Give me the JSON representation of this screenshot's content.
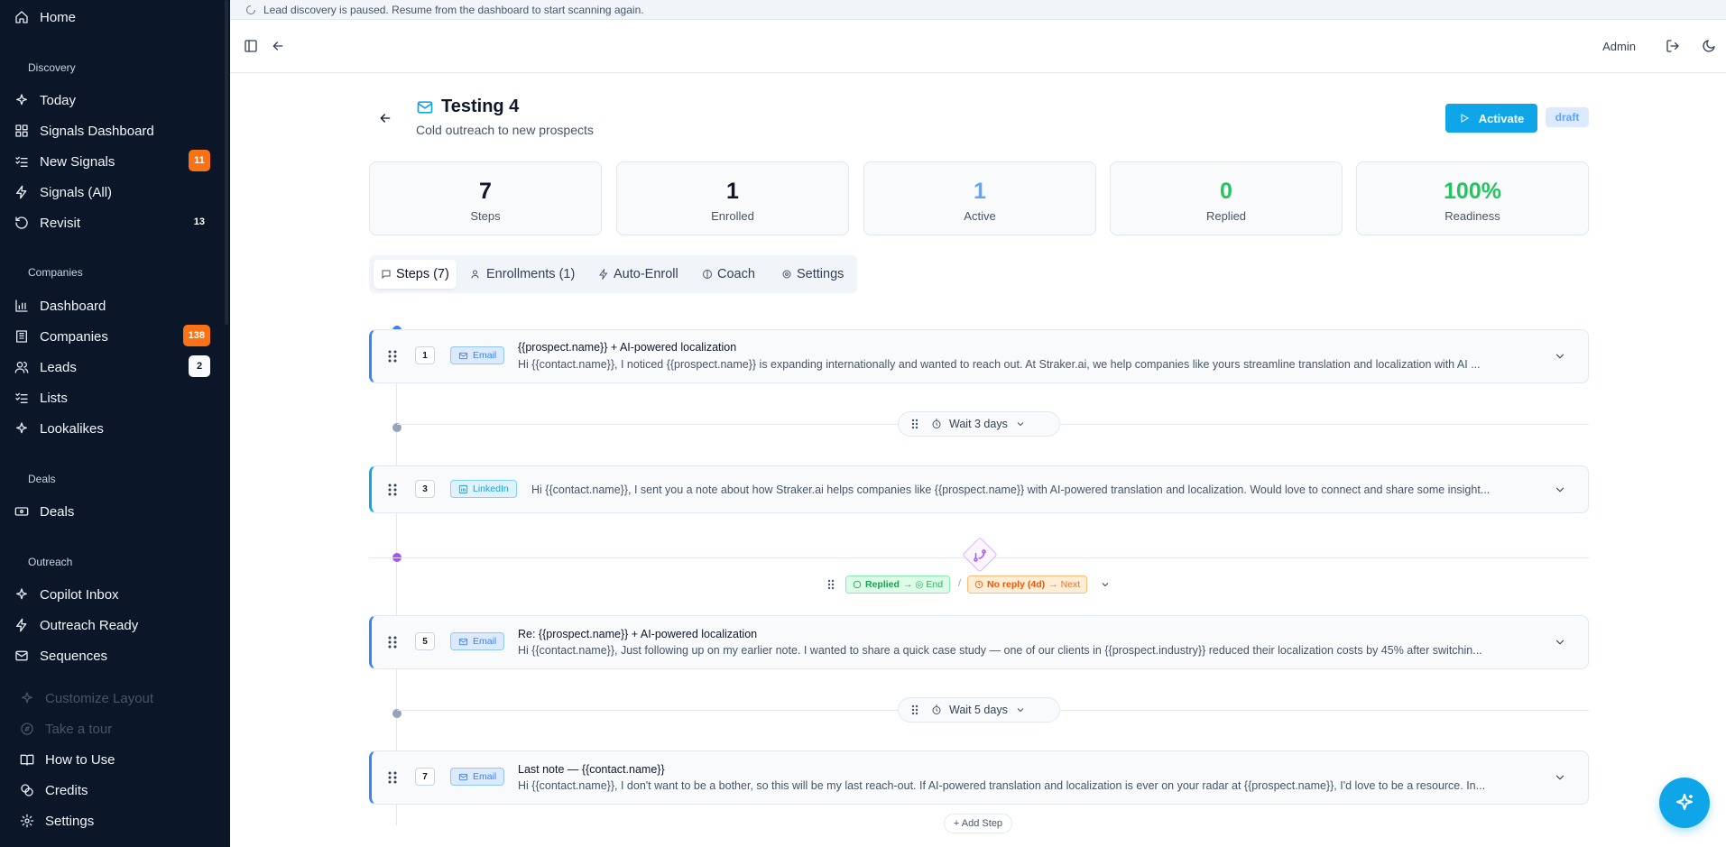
{
  "banner": {
    "text": "Lead discovery is paused. Resume from the dashboard to start scanning again."
  },
  "sidebar": {
    "home": "Home",
    "sections": {
      "discovery": "Discovery",
      "companies": "Companies",
      "deals": "Deals",
      "outreach": "Outreach"
    },
    "items": {
      "today": "Today",
      "signals_dashboard": "Signals Dashboard",
      "new_signals": "New Signals",
      "new_signals_badge": "11",
      "signals_all": "Signals (All)",
      "revisit": "Revisit",
      "revisit_badge": "13",
      "dashboard": "Dashboard",
      "companies": "Companies",
      "companies_badge": "138",
      "leads": "Leads",
      "leads_badge": "2",
      "lists": "Lists",
      "lookalikes": "Lookalikes",
      "deals": "Deals",
      "copilot_inbox": "Copilot Inbox",
      "outreach_ready": "Outreach Ready",
      "sequences": "Sequences",
      "customize_layout": "Customize Layout",
      "take_tour": "Take a tour",
      "how_to_use": "How to Use",
      "credits": "Credits",
      "settings": "Settings"
    }
  },
  "topbar": {
    "user": "Admin"
  },
  "sequence": {
    "title": "Testing 4",
    "subtitle": "Cold outreach to new prospects",
    "activate_label": "Activate",
    "status": "draft"
  },
  "stats": [
    {
      "value": "7",
      "label": "Steps",
      "color": "#0f172a"
    },
    {
      "value": "1",
      "label": "Enrolled",
      "color": "#0f172a"
    },
    {
      "value": "1",
      "label": "Active",
      "color": "#60a5fa"
    },
    {
      "value": "0",
      "label": "Replied",
      "color": "#22c55e"
    },
    {
      "value": "100%",
      "label": "Readiness",
      "color": "#22c55e"
    }
  ],
  "tabs": [
    {
      "label": "Steps (7)"
    },
    {
      "label": "Enrollments (1)"
    },
    {
      "label": "Auto-Enroll"
    },
    {
      "label": "Coach"
    },
    {
      "label": "Settings"
    }
  ],
  "steps": [
    {
      "num": "1",
      "channel": "Email",
      "title": "{{prospect.name}} + AI-powered localization",
      "body": "Hi {{contact.name}}, I noticed {{prospect.name}} is expanding internationally and wanted to reach out. At Straker.ai, we help companies like yours streamline translation and localization with AI ..."
    },
    {
      "num": "3",
      "channel": "LinkedIn",
      "title": "",
      "body": "Hi {{contact.name}}, I sent you a note about how Straker.ai helps companies like {{prospect.name}} with AI-powered translation and localization. Would love to connect and share some insight..."
    },
    {
      "num": "5",
      "channel": "Email",
      "title": "Re: {{prospect.name}} + AI-powered localization",
      "body": "Hi {{contact.name}}, Just following up on my earlier note. I wanted to share a quick case study — one of our clients in {{prospect.industry}} reduced their localization costs by 45% after switchin..."
    },
    {
      "num": "7",
      "channel": "Email",
      "title": "Last note — {{contact.name}}",
      "body": "Hi {{contact.name}}, I don't want to be a bother, so this will be my last reach-out. If AI-powered translation and localization is ever on your radar at {{prospect.name}}, I'd love to be a resource. In..."
    }
  ],
  "waits": [
    "Wait 3 days",
    "Wait 5 days"
  ],
  "branch": {
    "replied": "Replied",
    "replied_action": "→ ◎ End",
    "separator": "/",
    "no_reply": "No reply (4d)",
    "no_reply_action": "→ Next"
  },
  "add_step_label": "+ Add Step",
  "colors": {
    "accent": "#0ea5e9",
    "sidebar_bg": "#0b1729",
    "badge_orange": "#f97316"
  }
}
